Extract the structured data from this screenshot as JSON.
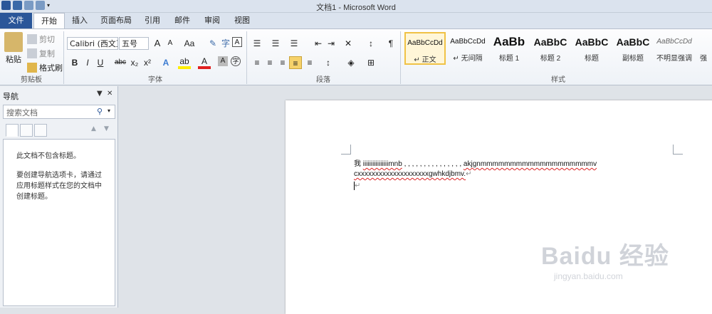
{
  "window": {
    "title": "文档1 - Microsoft Word"
  },
  "tabs": [
    "文件",
    "开始",
    "插入",
    "页面布局",
    "引用",
    "邮件",
    "审阅",
    "视图"
  ],
  "clipboard": {
    "paste": "粘贴",
    "cut": "剪切",
    "copy": "复制",
    "format_painter": "格式刷",
    "group_label": "剪贴板"
  },
  "font": {
    "name": "Calibri (西文正",
    "size": "五号",
    "group_label": "字体",
    "bold": "B",
    "italic": "I",
    "underline": "U",
    "strike": "abc",
    "subscript": "x₂",
    "superscript": "x²",
    "grow": "A",
    "shrink": "A",
    "change_case": "Aa"
  },
  "paragraph": {
    "group_label": "段落"
  },
  "styles": {
    "group_label": "样式",
    "items": [
      {
        "sample": "AaBbCcDd",
        "name": "↵ 正文"
      },
      {
        "sample": "AaBbCcDd",
        "name": "↵ 无间隔"
      },
      {
        "sample": "AaBb",
        "name": "标题 1"
      },
      {
        "sample": "AaBbC",
        "name": "标题 2"
      },
      {
        "sample": "AaBbC",
        "name": "标题"
      },
      {
        "sample": "AaBbC",
        "name": "副标题"
      },
      {
        "sample": "AaBbCcDd",
        "name": "不明显强调"
      },
      {
        "sample": "",
        "name": "强"
      }
    ]
  },
  "nav": {
    "title": "导航",
    "search_placeholder": "搜索文档",
    "msg1": "此文档不包含标题。",
    "msg2": "要创建导航选项卡，请通过应用标题样式在您的文档中创建标题。"
  },
  "document": {
    "line1_a": "我 ",
    "line1_b": "iiiiiiiiiiiiiiiimnb",
    "line1_c": ", , , , , , , , , , , , , , ,  ",
    "line1_d": "akjgnmmmmmmmmmmmmmmmmmmmv",
    "line2": "cxxxxxxxxxxxxxxxxxxxxgwhkdjbmv.",
    "line3": ""
  },
  "watermark": {
    "brand": "Baidu 经验",
    "url": "jingyan.baidu.com"
  }
}
